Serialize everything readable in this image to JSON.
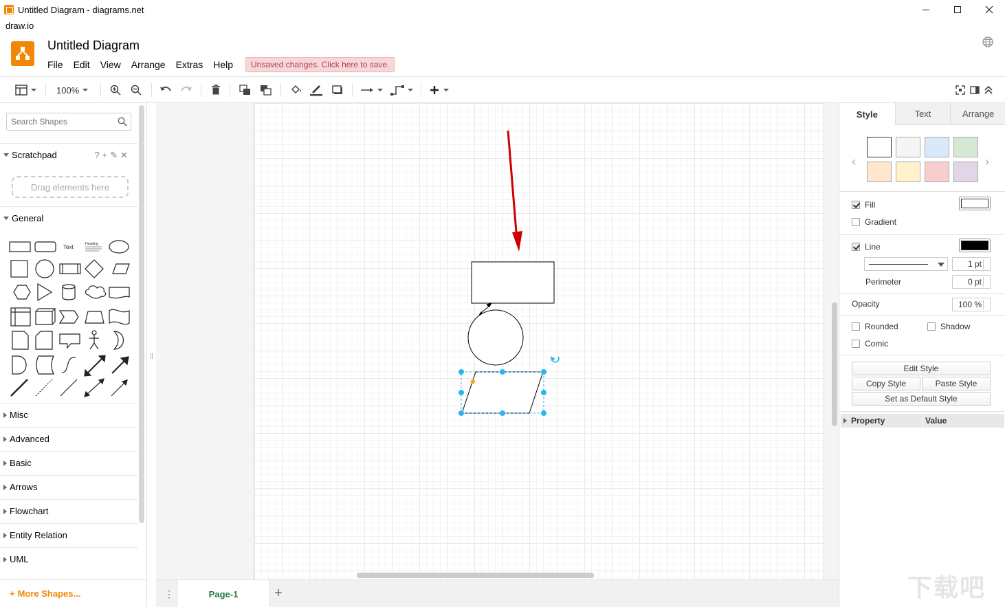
{
  "window": {
    "title": "Untitled Diagram - diagrams.net",
    "app_label": "draw.io",
    "minimize": "—",
    "maximize": "□",
    "close": "✕"
  },
  "header": {
    "doc_title": "Untitled Diagram",
    "menus": [
      "File",
      "Edit",
      "View",
      "Arrange",
      "Extras",
      "Help"
    ],
    "unsaved_notice": "Unsaved changes. Click here to save.",
    "brand_color": "#f08705"
  },
  "toolbar": {
    "zoom": "100%",
    "icons": [
      "format-panel-icon",
      "zoom-in-icon",
      "zoom-out-icon",
      "undo-icon",
      "redo-icon",
      "delete-icon",
      "to-front-icon",
      "to-back-icon",
      "fill-color-icon",
      "line-color-icon",
      "shadow-icon",
      "connection-icon",
      "waypoints-icon",
      "insert-icon",
      "fullscreen-icon",
      "toggle-panel-icon",
      "collapse-icon"
    ]
  },
  "sidebar": {
    "search_placeholder": "Search Shapes",
    "scratchpad": {
      "title": "Scratchpad",
      "tools": "?+✎✕",
      "dropzone": "Drag elements here"
    },
    "general": {
      "title": "General",
      "text_shape": "Text",
      "heading_shape": "Heading"
    },
    "sections": [
      "Misc",
      "Advanced",
      "Basic",
      "Arrows",
      "Flowchart",
      "Entity Relation",
      "UML"
    ],
    "more_shapes": "More Shapes..."
  },
  "pages": {
    "tabs": [
      "Page-1"
    ],
    "active": "Page-1"
  },
  "format_panel": {
    "tabs": [
      "Style",
      "Text",
      "Arrange"
    ],
    "active_tab": "Style",
    "swatches": [
      "#ffffff",
      "#f5f5f5",
      "#dae8fc",
      "#d5e8d4",
      "#ffe6cc",
      "#fff2cc",
      "#f8cecc",
      "#e1d5e7"
    ],
    "fill": {
      "label": "Fill",
      "checked": true,
      "color": "#ffffff"
    },
    "gradient": {
      "label": "Gradient",
      "checked": false
    },
    "line": {
      "label": "Line",
      "checked": true,
      "color": "#000000",
      "width": "1 pt"
    },
    "perimeter": {
      "label": "Perimeter",
      "value": "0 pt"
    },
    "opacity": {
      "label": "Opacity",
      "value": "100 %"
    },
    "rounded": {
      "label": "Rounded",
      "checked": false
    },
    "shadow": {
      "label": "Shadow",
      "checked": false
    },
    "comic": {
      "label": "Comic",
      "checked": false
    },
    "buttons": {
      "edit_style": "Edit Style",
      "copy_style": "Copy Style",
      "paste_style": "Paste Style",
      "default_style": "Set as Default Style"
    },
    "property_table": {
      "col_property": "Property",
      "col_value": "Value"
    }
  },
  "canvas": {
    "selection_color": "#29b6f2",
    "arrow_color": "#cc0000"
  },
  "watermark": "下载吧"
}
